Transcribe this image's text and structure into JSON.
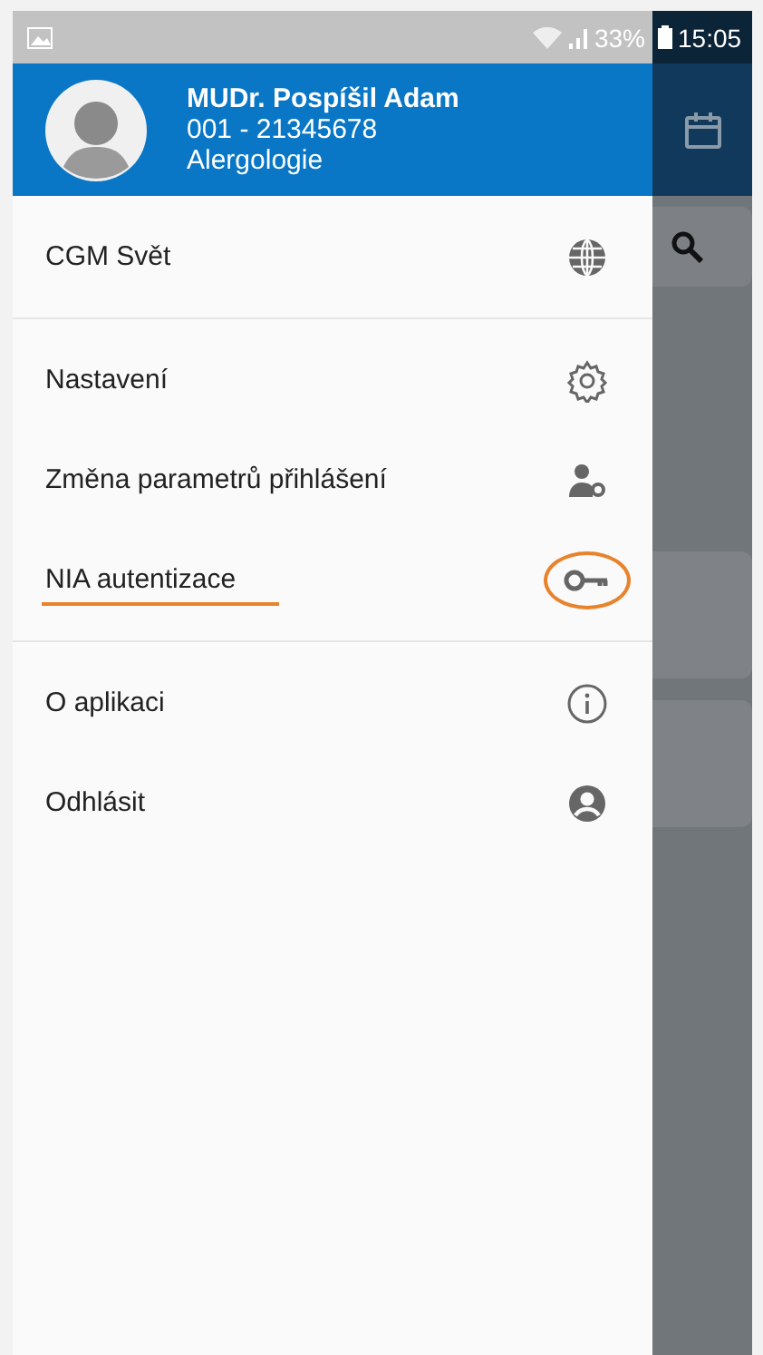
{
  "status_bar": {
    "battery": "33%",
    "time": "15:05"
  },
  "profile": {
    "name": "MUDr. Pospíšil Adam",
    "id": "001 - 21345678",
    "specialty": "Alergologie"
  },
  "menu_groups": [
    [
      {
        "label": "CGM Svět",
        "annotated": false
      }
    ],
    [
      {
        "label": "Nastavení",
        "annotated": false
      },
      {
        "label": "Změna parametrů přihlášení",
        "annotated": false
      },
      {
        "label": "NIA autentizace",
        "annotated": true
      }
    ],
    [
      {
        "label": "O aplikaci",
        "annotated": false
      },
      {
        "label": "Odhlásit",
        "annotated": false
      }
    ]
  ]
}
